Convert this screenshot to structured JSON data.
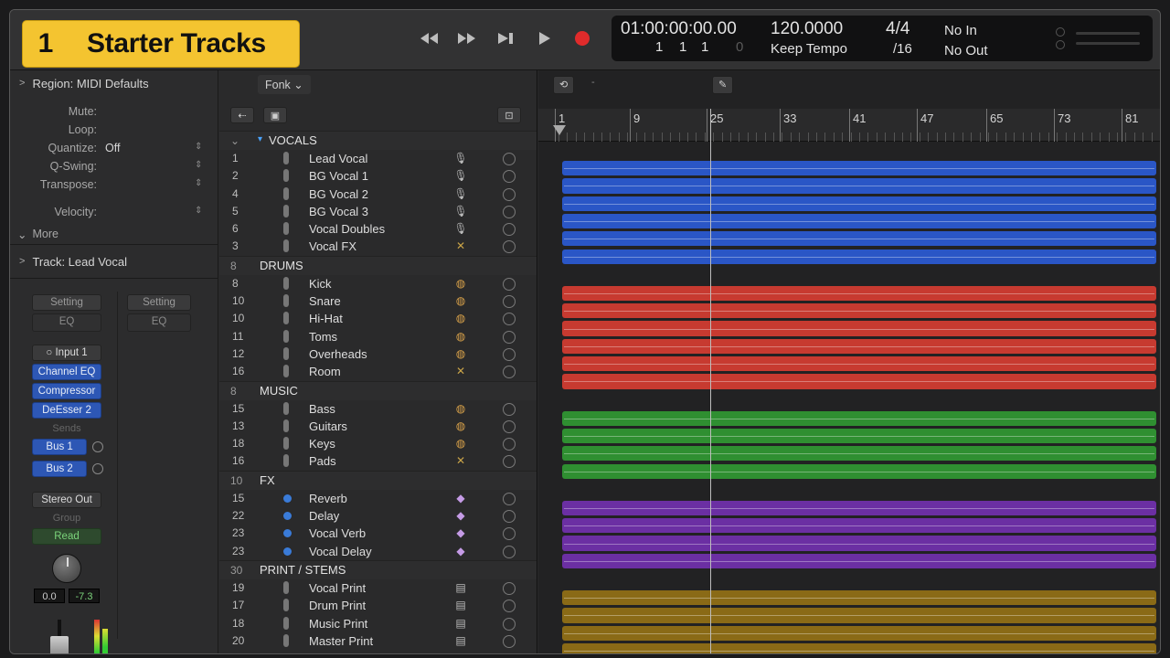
{
  "project": {
    "number": "1",
    "name": "Starter Tracks"
  },
  "lcd": {
    "timecode": "01:00:00:00.00",
    "bars": [
      "1",
      "1",
      "1",
      "0"
    ],
    "tempo": "120.0000",
    "tempo_mode": "Keep Tempo",
    "signature": "4/4",
    "division": "/16",
    "midi_in": "No In",
    "midi_out": "No Out"
  },
  "inspector": {
    "region_header": "Region: MIDI Defaults",
    "params": [
      {
        "label": "Mute:",
        "value": ""
      },
      {
        "label": "Loop:",
        "value": ""
      },
      {
        "label": "Quantize:",
        "value": "Off"
      },
      {
        "label": "Q-Swing:",
        "value": ""
      },
      {
        "label": "Transpose:",
        "value": ""
      },
      {
        "label": "Velocity:",
        "value": ""
      }
    ],
    "more": "More",
    "track_header": "Track: Lead Vocal",
    "strip1": {
      "setting": "Setting",
      "eq": "EQ",
      "input": "Input 1",
      "plugins": [
        "Channel EQ",
        "Compressor",
        "DeEsser 2"
      ],
      "sends_caption": "Sends",
      "buses": [
        "Bus 1",
        "Bus 2"
      ],
      "output": "Stereo Out",
      "group_caption": "Group",
      "automation": "Read",
      "volume": "0.0",
      "peak": "-7.3"
    },
    "strip2": {
      "setting": "Setting",
      "eq": "EQ"
    }
  },
  "tracklist": {
    "view_menu": "Fonk",
    "groups": [
      {
        "num": "",
        "name": "VOCALS",
        "color": "blue",
        "tracks": [
          {
            "num": "1",
            "name": "Lead Vocal",
            "icon": "mic-icon"
          },
          {
            "num": "2",
            "name": "BG Vocal 1",
            "icon": "mic-icon"
          },
          {
            "num": "4",
            "name": "BG Vocal 2",
            "icon": "mic-icon"
          },
          {
            "num": "5",
            "name": "BG Vocal 3",
            "icon": "mic-icon"
          },
          {
            "num": "6",
            "name": "Vocal Doubles",
            "icon": "mic-icon"
          },
          {
            "num": "3",
            "name": "Vocal FX",
            "icon": "fx-x-icon"
          }
        ]
      },
      {
        "num": "8",
        "name": "DRUMS",
        "color": "red",
        "tracks": [
          {
            "num": "8",
            "name": "Kick",
            "icon": "drum-icon"
          },
          {
            "num": "10",
            "name": "Snare",
            "icon": "drum-icon"
          },
          {
            "num": "10",
            "name": "Hi-Hat",
            "icon": "drum-icon"
          },
          {
            "num": "11",
            "name": "Toms",
            "icon": "drum-icon"
          },
          {
            "num": "12",
            "name": "Overheads",
            "icon": "drum-icon"
          },
          {
            "num": "16",
            "name": "Room",
            "icon": "fx-x-icon"
          }
        ]
      },
      {
        "num": "8",
        "name": "MUSIC",
        "color": "green",
        "tracks": [
          {
            "num": "15",
            "name": "Bass",
            "icon": "drum-icon"
          },
          {
            "num": "13",
            "name": "Guitars",
            "icon": "drum-icon"
          },
          {
            "num": "18",
            "name": "Keys",
            "icon": "drum-icon"
          },
          {
            "num": "16",
            "name": "Pads",
            "icon": "fx-x-icon"
          }
        ]
      },
      {
        "num": "10",
        "name": "FX",
        "color": "purple",
        "tracks": [
          {
            "num": "15",
            "name": "Reverb",
            "icon": "synth-icon"
          },
          {
            "num": "22",
            "name": "Delay",
            "icon": "synth-icon"
          },
          {
            "num": "23",
            "name": "Vocal Verb",
            "icon": "synth-icon"
          },
          {
            "num": "23",
            "name": "Vocal Delay",
            "icon": "synth-icon"
          }
        ]
      },
      {
        "num": "30",
        "name": "PRINT / STEMS",
        "color": "gold",
        "tracks": [
          {
            "num": "19",
            "name": "Vocal Print",
            "icon": "print-icon"
          },
          {
            "num": "17",
            "name": "Drum Print",
            "icon": "print-icon"
          },
          {
            "num": "18",
            "name": "Music Print",
            "icon": "print-icon"
          },
          {
            "num": "20",
            "name": "Master Print",
            "icon": "print-icon"
          }
        ]
      }
    ]
  },
  "ruler": {
    "bars": [
      "1",
      "9",
      "25",
      "33",
      "41",
      "47",
      "65",
      "73",
      "81"
    ]
  },
  "colors": {
    "blue": "#2a56c6",
    "red": "#c73a30",
    "green": "#2f8f31",
    "purple": "#6b2fa3",
    "gold": "#8a6a16",
    "accent": "#f4c430"
  }
}
